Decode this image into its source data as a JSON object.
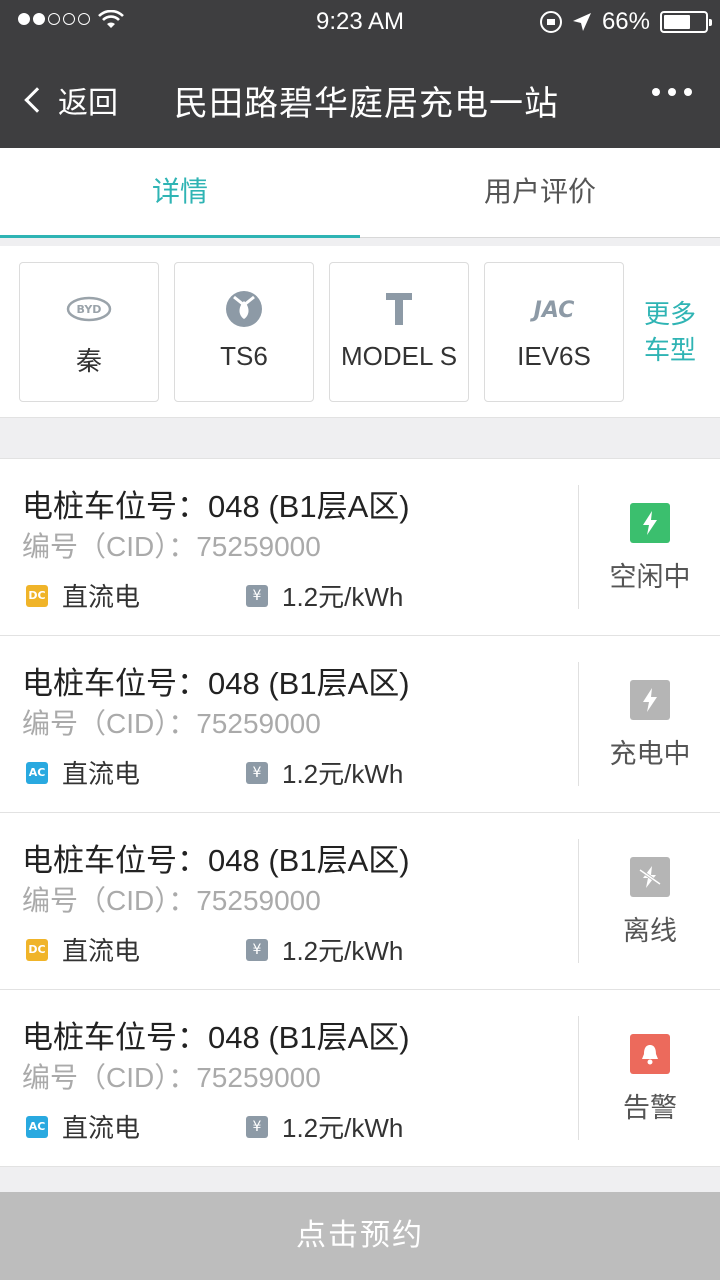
{
  "status_bar": {
    "time": "9:23 AM",
    "battery": "66%",
    "battery_level": 0.66,
    "signal_bars": 2
  },
  "nav": {
    "back_label": "返回",
    "title": "民田路碧华庭居充电一站",
    "more_icon": "more-dots-icon"
  },
  "tabs": [
    {
      "label": "详情",
      "active": true
    },
    {
      "label": "用户评价",
      "active": false
    }
  ],
  "models": {
    "items": [
      {
        "name": "秦",
        "logo": "byd-logo",
        "logo_text": "BYD"
      },
      {
        "name": "TS6",
        "logo": "tengshi-logo"
      },
      {
        "name": "MODEL S",
        "logo": "tesla-logo"
      },
      {
        "name": "IEV6S",
        "logo": "jac-logo",
        "logo_text": "JAC"
      }
    ],
    "more_label": "更多车型"
  },
  "piles": [
    {
      "position": "电桩车位号：048 (B1层A区)",
      "cid": "编号（CID）：75259000",
      "current_type": "DC",
      "current_label": "直流电",
      "price": "1.2元/kWh",
      "state": "空闲中",
      "state_color": "#3bbf6e",
      "state_icon": "bolt-icon"
    },
    {
      "position": "电桩车位号：048 (B1层A区)",
      "cid": "编号（CID）：75259000",
      "current_type": "AC",
      "current_label": "直流电",
      "price": "1.2元/kWh",
      "state": "充电中",
      "state_color": "#b5b5b5",
      "state_icon": "bolt-icon"
    },
    {
      "position": "电桩车位号：048 (B1层A区)",
      "cid": "编号（CID）：75259000",
      "current_type": "DC",
      "current_label": "直流电",
      "price": "1.2元/kWh",
      "state": "离线",
      "state_color": "#b5b5b5",
      "state_icon": "offline-bolt-icon"
    },
    {
      "position": "电桩车位号：048 (B1层A区)",
      "cid": "编号（CID）：75259000",
      "current_type": "AC",
      "current_label": "直流电",
      "price": "1.2元/kWh",
      "state": "告警",
      "state_color": "#ec6a5c",
      "state_icon": "bell-icon"
    }
  ],
  "yen_symbol": "¥",
  "reserve_button": "点击预约",
  "colors": {
    "accent": "#2fb4b4",
    "header_bg": "#3e3e40",
    "dc_badge": "#f0b429",
    "ac_badge": "#29a9e0"
  }
}
